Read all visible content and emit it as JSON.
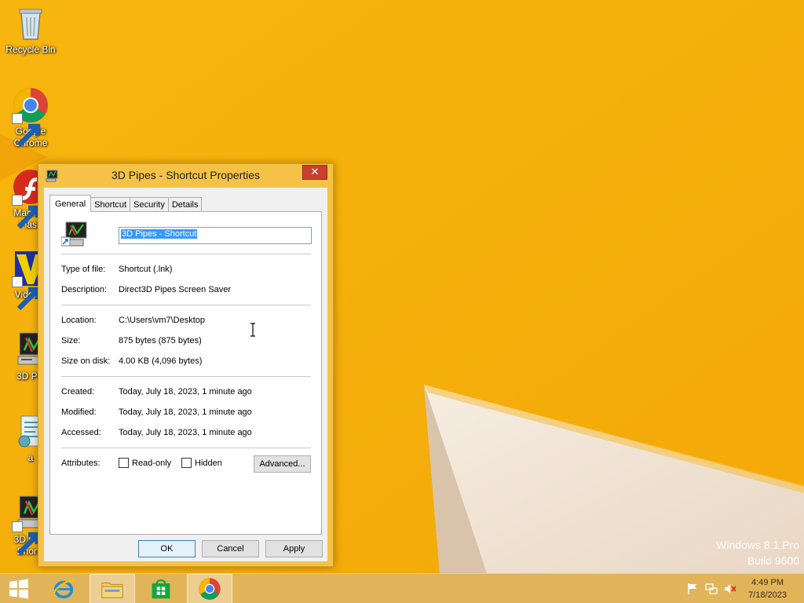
{
  "desktop": {
    "icons": [
      {
        "label": "Recycle Bin",
        "icon": "recycle-bin-icon"
      },
      {
        "label": "Google\nChrome",
        "icon": "chrome-icon"
      },
      {
        "label": "Macrom\nFlash",
        "icon": "flash-icon"
      },
      {
        "label": "VideoM",
        "icon": "videom-icon"
      },
      {
        "label": "3D Pip",
        "icon": "3d-pipes-icon"
      },
      {
        "label": "a",
        "icon": "script-icon"
      },
      {
        "label": "3D Pipe\nShortc",
        "icon": "3d-pipes-shortcut-icon"
      }
    ],
    "watermark": {
      "line1": "Windows 8.1 Pro",
      "line2": "Build 9600"
    },
    "colors": {
      "background": "#f6b20c",
      "accent_white": "#f2e6d8"
    }
  },
  "dialog": {
    "title": "3D Pipes - Shortcut Properties",
    "close_label": "✕",
    "tabs": [
      {
        "label": "General",
        "active": true
      },
      {
        "label": "Shortcut",
        "active": false
      },
      {
        "label": "Security",
        "active": false
      },
      {
        "label": "Details",
        "active": false
      }
    ],
    "name_value": "3D Pipes - Shortcut",
    "type_of_file": {
      "label": "Type of file:",
      "value": "Shortcut (.lnk)"
    },
    "description": {
      "label": "Description:",
      "value": "Direct3D Pipes Screen Saver"
    },
    "location": {
      "label": "Location:",
      "value": "C:\\Users\\vm7\\Desktop"
    },
    "size": {
      "label": "Size:",
      "value": "875 bytes (875 bytes)"
    },
    "size_on_disk": {
      "label": "Size on disk:",
      "value": "4.00 KB (4,096 bytes)"
    },
    "created": {
      "label": "Created:",
      "value": "Today, July 18, 2023, 1 minute ago"
    },
    "modified": {
      "label": "Modified:",
      "value": "Today, July 18, 2023, 1 minute ago"
    },
    "accessed": {
      "label": "Accessed:",
      "value": "Today, July 18, 2023, 1 minute ago"
    },
    "attributes": {
      "label": "Attributes:",
      "read_only": {
        "label": "Read-only",
        "checked": false
      },
      "hidden": {
        "label": "Hidden",
        "checked": false
      },
      "advanced_label": "Advanced..."
    },
    "buttons": {
      "ok": "OK",
      "cancel": "Cancel",
      "apply": "Apply"
    }
  },
  "taskbar": {
    "items": [
      "start-icon",
      "internet-explorer-icon",
      "file-explorer-icon",
      "store-icon",
      "chrome-icon"
    ],
    "clock": {
      "time": "4:49 PM",
      "date": "7/18/2023"
    },
    "tray": [
      "flag-icon",
      "network-icon",
      "volume-muted-icon"
    ]
  }
}
